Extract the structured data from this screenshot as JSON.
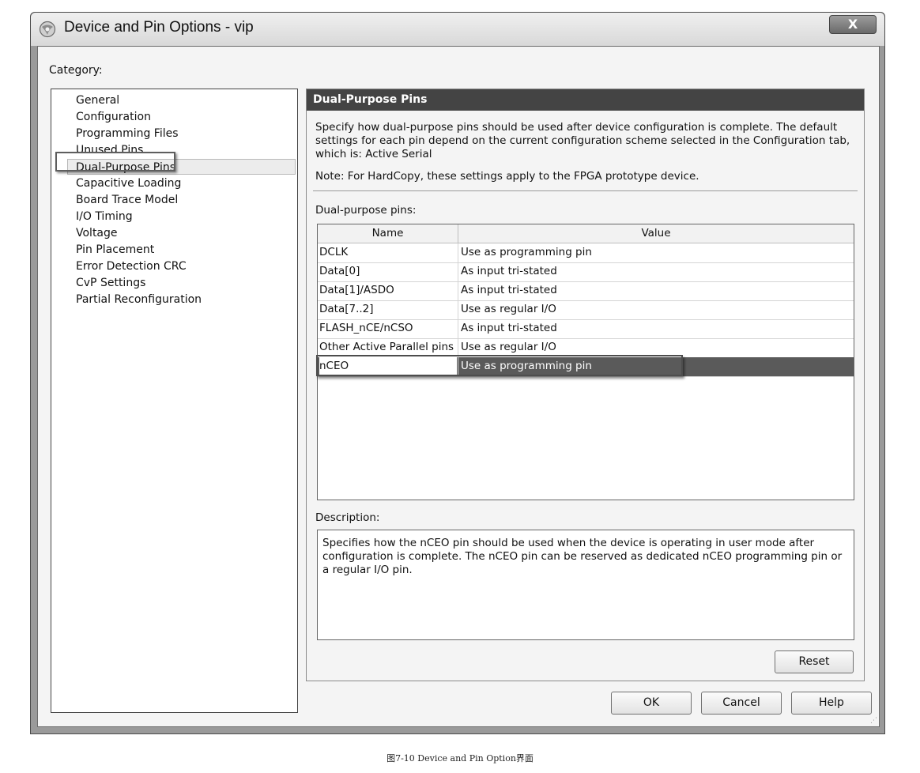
{
  "window": {
    "title": "Device and Pin Options - vip",
    "close_label": "X"
  },
  "category": {
    "label": "Category:",
    "items": [
      "General",
      "Configuration",
      "Programming Files",
      "Unused Pins",
      "Dual-Purpose Pins",
      "Capacitive Loading",
      "Board Trace Model",
      "I/O Timing",
      "Voltage",
      "Pin Placement",
      "Error Detection CRC",
      "CvP Settings",
      "Partial Reconfiguration"
    ],
    "selected": "Dual-Purpose Pins"
  },
  "panel": {
    "header": "Dual-Purpose Pins",
    "description": "Specify how dual-purpose pins should be used after device configuration is complete. The default settings for each pin depend on the current configuration scheme selected in the Configuration tab, which is:  Active Serial",
    "note": "Note: For HardCopy, these settings apply to the FPGA prototype device.",
    "pins_label": "Dual-purpose pins:",
    "columns": [
      "Name",
      "Value"
    ],
    "rows": [
      {
        "name": "DCLK",
        "value": "Use as programming pin"
      },
      {
        "name": "Data[0]",
        "value": "As input tri-stated"
      },
      {
        "name": "Data[1]/ASDO",
        "value": "As input tri-stated"
      },
      {
        "name": "Data[7..2]",
        "value": "Use as regular I/O"
      },
      {
        "name": "FLASH_nCE/nCSO",
        "value": "As input tri-stated"
      },
      {
        "name": "Other Active Parallel pins",
        "value": "Use as regular I/O"
      },
      {
        "name": "nCEO",
        "value": "Use as programming pin"
      }
    ],
    "selected_row": "nCEO",
    "description_label": "Description:",
    "description_text": "Specifies how the nCEO pin should be used when the device is operating in user mode after configuration is complete. The nCEO pin can be reserved as dedicated nCEO programming pin or a regular I/O pin.",
    "reset_label": "Reset"
  },
  "buttons": {
    "ok": "OK",
    "cancel": "Cancel",
    "help": "Help"
  },
  "caption": "图7-10   Device and Pin Option界面"
}
